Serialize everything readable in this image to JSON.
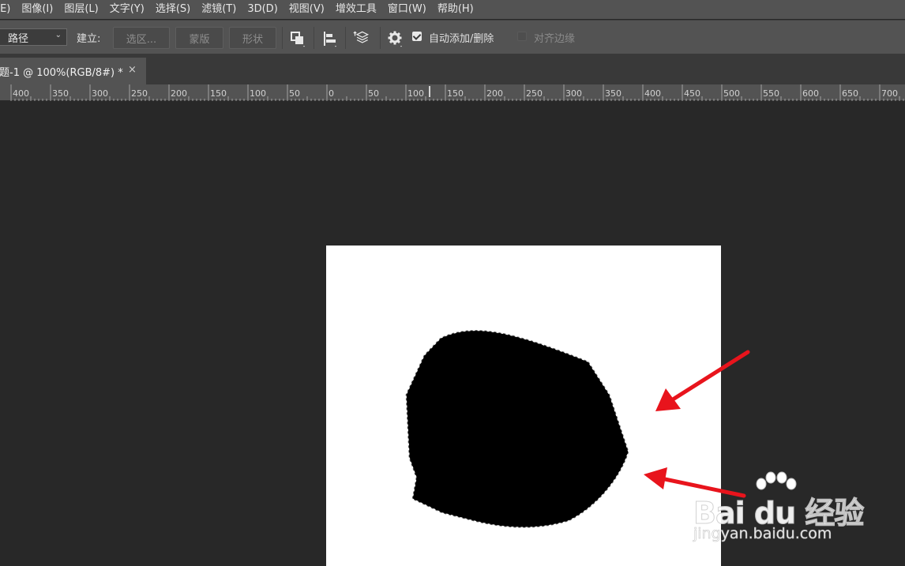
{
  "menubar": {
    "items": [
      {
        "label": "(E)"
      },
      {
        "label": "图像(I)"
      },
      {
        "label": "图层(L)"
      },
      {
        "label": "文字(Y)"
      },
      {
        "label": "选择(S)"
      },
      {
        "label": "滤镜(T)"
      },
      {
        "label": "3D(D)"
      },
      {
        "label": "视图(V)"
      },
      {
        "label": "增效工具"
      },
      {
        "label": "窗口(W)"
      },
      {
        "label": "帮助(H)"
      }
    ]
  },
  "options": {
    "mode_select": "路径",
    "make_label": "建立:",
    "selection_button": "选区...",
    "mask_button": "蒙版",
    "shape_button": "形状",
    "auto_add_delete_label": "自动添加/删除",
    "auto_add_delete_checked": true,
    "align_edges_label": "对齐边缘",
    "align_edges_checked": false
  },
  "tab": {
    "title": "题-1 @ 100%(RGB/8#) *",
    "close": "×"
  },
  "ruler": {
    "labels": [
      "400",
      "350",
      "300",
      "250",
      "200",
      "150",
      "100",
      "50",
      "0",
      "50",
      "100",
      "150",
      "200",
      "250",
      "300",
      "350",
      "400",
      "450",
      "500",
      "550",
      "600",
      "650",
      "700"
    ]
  },
  "watermark": {
    "line1": "Bai du 经验",
    "line2": "jingyan.baidu.com"
  },
  "colors": {
    "panel": "#535353",
    "workspace": "#282828",
    "arrow": "#e8141c"
  }
}
